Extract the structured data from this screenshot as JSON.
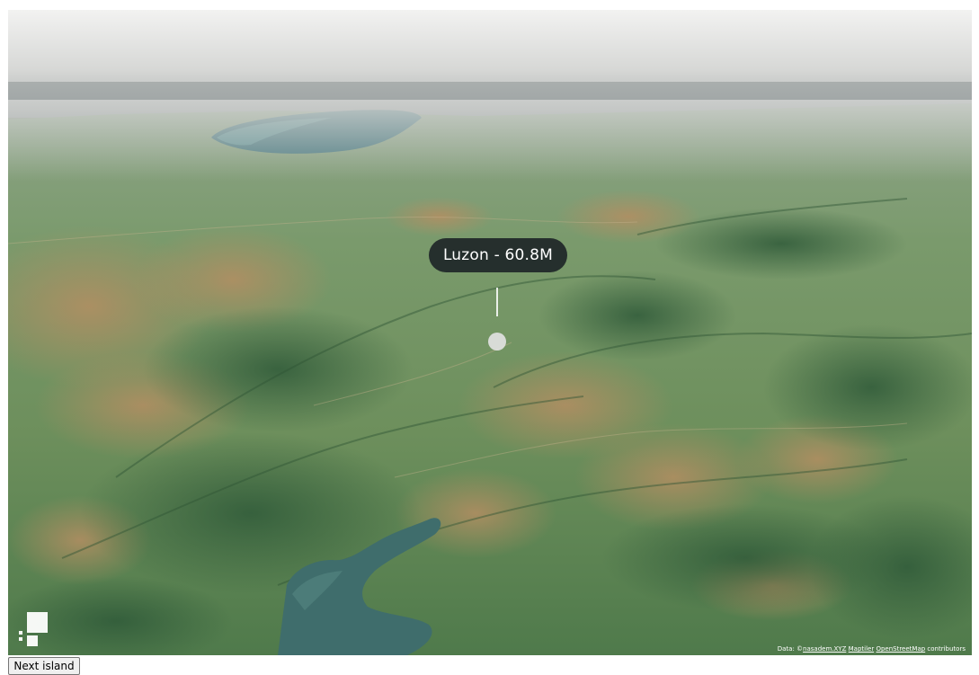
{
  "map": {
    "popup_label": "Luzon - 60.8M",
    "attribution": {
      "prefix": "Data: ©",
      "links": [
        "nasadem.XYZ",
        "Maptiler",
        "OpenStreetMap"
      ],
      "suffix": "contributors"
    },
    "colors": {
      "sky": "#dcdcdb",
      "haze": "#b9bdbc",
      "water": "#4f7f86",
      "terrain_green": "#5e8a57",
      "terrain_dark": "#3f6b45",
      "terrain_brown": "#a8885f",
      "popup_bg": "#1e2628"
    },
    "logo_icon": "maplibre-logo-icon",
    "marker_icon": "marker-dot-icon"
  },
  "controls": {
    "next_button_label": "Next island"
  }
}
